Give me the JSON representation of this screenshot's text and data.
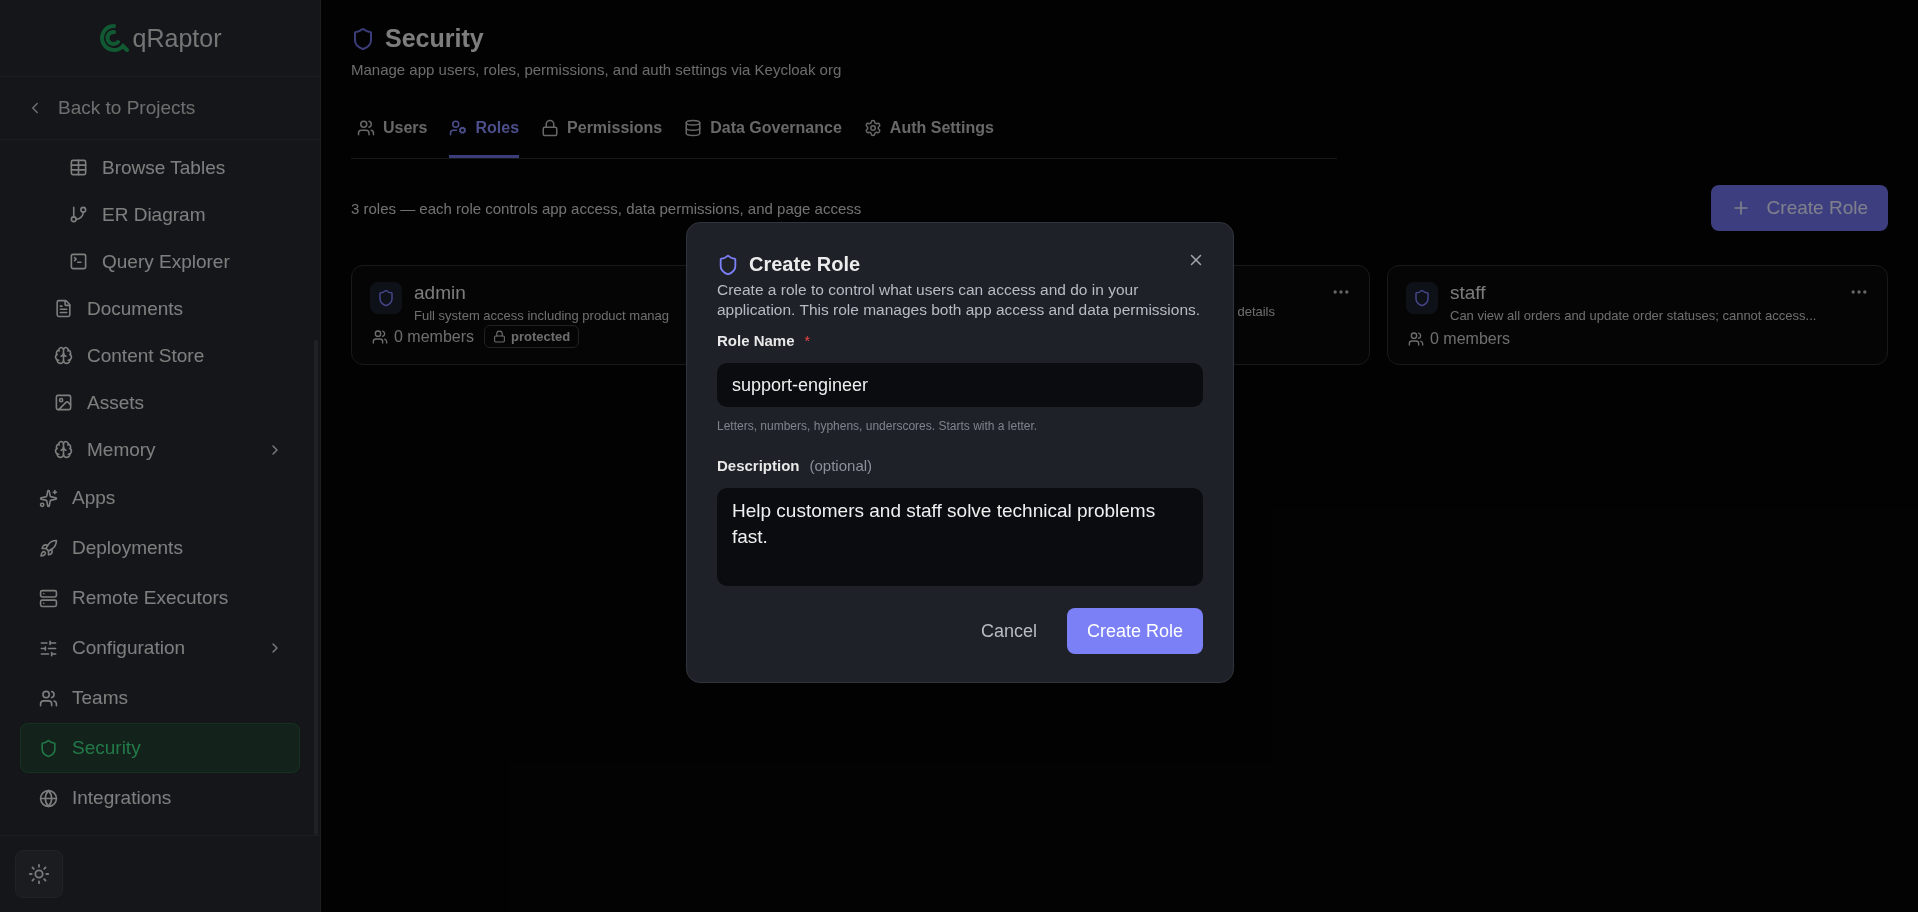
{
  "sidebar": {
    "logo": "qRaptor",
    "back_link": "Back to Projects",
    "items": [
      {
        "children": [
          {
            "children": [
              {
                "label": "Browse Tables",
                "selected": false,
                "has_submenu": false
              },
              {
                "label": "ER Diagram",
                "selected": false,
                "has_submenu": false
              },
              {
                "label": "Query Explorer",
                "selected": false,
                "has_submenu": false
              }
            ]
          },
          {
            "label": "Documents",
            "selected": false,
            "has_submenu": false
          },
          {
            "label": "Content Store",
            "selected": false,
            "has_submenu": false
          },
          {
            "label": "Assets",
            "selected": false,
            "has_submenu": false
          },
          {
            "label": "Memory",
            "selected": false,
            "has_submenu": true
          }
        ]
      },
      {
        "label": "Apps",
        "selected": false,
        "has_submenu": false
      },
      {
        "label": "Deployments",
        "selected": false,
        "has_submenu": false
      },
      {
        "label": "Remote Executors",
        "selected": false,
        "has_submenu": false
      },
      {
        "label": "Configuration",
        "selected": false,
        "has_submenu": true
      },
      {
        "label": "Teams",
        "selected": false,
        "has_submenu": false
      },
      {
        "label": "Security",
        "selected": true,
        "has_submenu": false
      },
      {
        "label": "Integrations",
        "selected": false,
        "has_submenu": false
      }
    ]
  },
  "page": {
    "title": "Security",
    "subtitle": "Manage app users, roles, permissions, and auth settings via Keycloak org",
    "tabs": [
      {
        "label": "Users",
        "selected": false
      },
      {
        "label": "Roles",
        "selected": true
      },
      {
        "label": "Permissions",
        "selected": false
      },
      {
        "label": "Data Governance",
        "selected": false
      },
      {
        "label": "Auth Settings",
        "selected": false
      }
    ],
    "summary": "3 roles — each role controls app access, data permissions, and page access",
    "create_button": "Create Role",
    "roles": [
      {
        "name": "admin",
        "description": "Full system access including product manag",
        "members": "0 members",
        "badge": "protected"
      },
      {
        "description": "details"
      },
      {
        "name": "staff",
        "description": "Can view all orders and update order statuses; cannot access...",
        "members": "0 members"
      }
    ]
  },
  "dialog": {
    "title": "Create Role",
    "description": "Create a role to control what users can access and do in your application. This role manages both app access and data permissions.",
    "name_field": {
      "label": "Role Name",
      "required_mark": "*",
      "value": "support-engineer",
      "hint": "Letters, numbers, hyphens, underscores. Starts with a letter."
    },
    "description_field": {
      "label": "Description",
      "note": "(optional)",
      "value": "Help customers and staff solve technical problems fast."
    },
    "buttons": {
      "cancel": "Cancel",
      "submit": "Create Role"
    }
  }
}
